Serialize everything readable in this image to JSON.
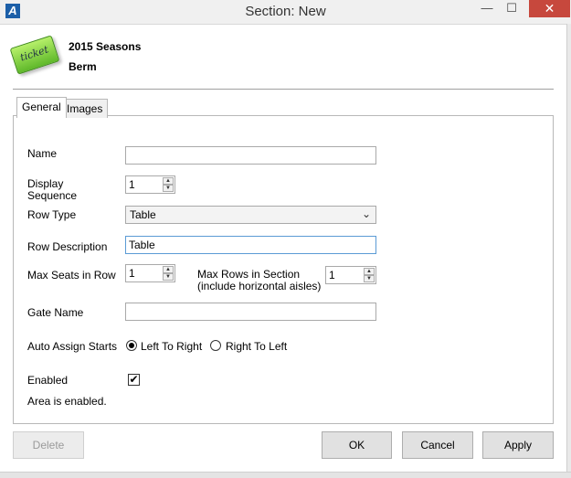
{
  "window": {
    "title": "Section: New",
    "app_icon_glyph": "A",
    "minimize_glyph": "—",
    "maximize_glyph": "☐",
    "close_glyph": "✕"
  },
  "header": {
    "icon_text": "ticket",
    "line1": "2015 Seasons",
    "line2": "Berm"
  },
  "tabs": [
    {
      "label": "General",
      "active": true
    },
    {
      "label": "Images",
      "active": false
    }
  ],
  "form": {
    "name_label": "Name",
    "name_value": "",
    "display_sequence_label_1": "Display",
    "display_sequence_label_2": "Sequence",
    "display_sequence_value": "1",
    "row_type_label": "Row Type",
    "row_type_value": "Table",
    "row_description_label": "Row Description",
    "row_description_value": "Table",
    "max_seats_label": "Max Seats in Row",
    "max_seats_value": "1",
    "max_rows_label_1": "Max Rows in Section",
    "max_rows_label_2": "(include horizontal aisles)",
    "max_rows_value": "1",
    "gate_name_label": "Gate Name",
    "gate_name_value": "",
    "auto_assign_label": "Auto Assign Starts",
    "auto_assign_options": [
      {
        "label": "Left To Right",
        "checked": true
      },
      {
        "label": "Right To Left",
        "checked": false
      }
    ],
    "enabled_label": "Enabled",
    "enabled_checked": true,
    "checkmark_glyph": "✔",
    "status_text": "Area is enabled."
  },
  "buttons": {
    "delete": "Delete",
    "ok": "OK",
    "cancel": "Cancel",
    "apply": "Apply"
  },
  "colors": {
    "close_button": "#c7483d",
    "focus_border": "#5b9bd5",
    "ticket_green": "#5fb82a"
  }
}
